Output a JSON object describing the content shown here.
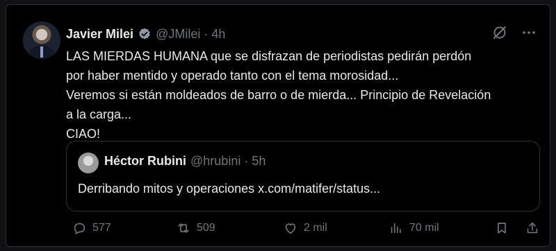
{
  "tweet": {
    "author_name": "Javier Milei",
    "handle": "@JMilei",
    "separator": "·",
    "time": "4h",
    "lines": [
      "LAS MIERDAS HUMANA que se disfrazan de periodistas pedirán perdón",
      "por haber mentido y operado tanto con el tema morosidad...",
      "Veremos si están moldeados de barro o de mierda... Principio de Revelación",
      "a la carga...",
      "CIAO!"
    ],
    "quote": {
      "author_name": "Héctor Rubini",
      "handle": "@hrubini",
      "separator": "·",
      "time": "5h",
      "text": "Derribando mitos y operaciones x.com/matifer/status..."
    },
    "actions": {
      "replies": "577",
      "reposts": "509",
      "likes": "2 mil",
      "views": "70 mil"
    }
  },
  "icons": {
    "verified": "verified-badge-icon",
    "grok": "grok-icon",
    "more": "more-icon",
    "reply": "reply-icon",
    "repost": "repost-icon",
    "like": "heart-icon",
    "views": "views-icon",
    "bookmark": "bookmark-icon",
    "share": "share-icon"
  },
  "colors": {
    "background": "#000000",
    "text": "#e7e9ea",
    "muted": "#71767b",
    "border": "#2f3336",
    "verified": "#8b98a5"
  }
}
